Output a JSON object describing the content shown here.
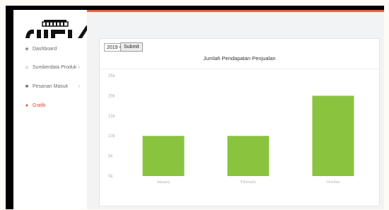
{
  "sidebar": {
    "items": [
      {
        "label": "Dashboard",
        "icon": "dashboard-icon",
        "glyph": "◈",
        "has_chevron": false,
        "active": false
      },
      {
        "label": "Sumberdata Produk",
        "icon": "tag-icon",
        "glyph": "⌂",
        "has_chevron": true,
        "active": false
      },
      {
        "label": "Pesanan Masuk",
        "icon": "folder-icon",
        "glyph": "■",
        "has_chevron": true,
        "active": false
      },
      {
        "label": "Grafik",
        "icon": "chart-icon",
        "glyph": "●",
        "has_chevron": false,
        "active": true
      }
    ],
    "chevron": "›"
  },
  "filter": {
    "year": "2019",
    "year_arrow": "▾",
    "submit_label": "Submit"
  },
  "colors": {
    "accent": "#e8643b",
    "active": "#e8452c",
    "bar": "#8ac43f"
  },
  "chart_data": {
    "type": "bar",
    "title": "Jumlah Pendapatan Penjualan",
    "categories": [
      "January",
      "February",
      "October"
    ],
    "values": [
      10,
      10,
      20
    ],
    "ylim": [
      0,
      25
    ],
    "yticks": [
      "0k",
      "5k",
      "10k",
      "15k",
      "20k",
      "25k"
    ],
    "ytick_values": [
      0,
      5,
      10,
      15,
      20,
      25
    ],
    "grid": false,
    "legend": "none"
  }
}
